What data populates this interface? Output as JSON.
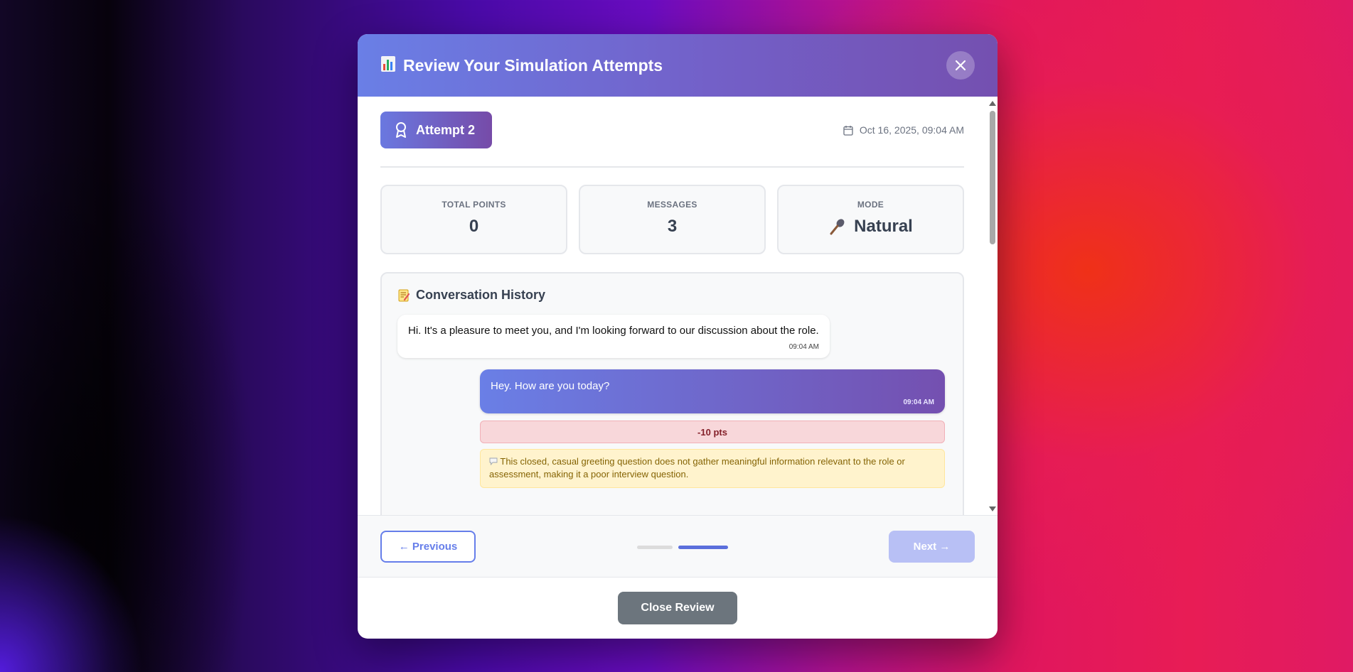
{
  "modal": {
    "title": "Review Your Simulation Attempts",
    "header_icon": "bar-chart-icon"
  },
  "attempt": {
    "label": "Attempt 2",
    "date": "Oct 16, 2025, 09:04 AM"
  },
  "stats": [
    {
      "label": "TOTAL POINTS",
      "value": "0"
    },
    {
      "label": "MESSAGES",
      "value": "3"
    },
    {
      "label": "MODE",
      "value": "Natural",
      "icon": "microphone-icon"
    }
  ],
  "history": {
    "title": "Conversation History",
    "messages": [
      {
        "side": "left",
        "text": "Hi. It's a pleasure to meet you, and I'm looking forward to our discussion about the role.",
        "time": "09:04 AM"
      },
      {
        "side": "right",
        "text": "Hey. How are you today?",
        "time": "09:04 AM",
        "points": "-10 pts",
        "feedback": "This closed, casual greeting question does not gather meaningful information relevant to the role or assessment, making it a poor interview question."
      }
    ]
  },
  "nav": {
    "previous_label": "← Previous",
    "next_label": "Next →",
    "page_count": 2,
    "current_page": 2
  },
  "footer": {
    "close_label": "Close Review"
  },
  "colors": {
    "accent": "#667eea",
    "accent_dark": "#764ba2",
    "penalty_bg": "#f8d7da",
    "feedback_bg": "#fff3cd"
  }
}
